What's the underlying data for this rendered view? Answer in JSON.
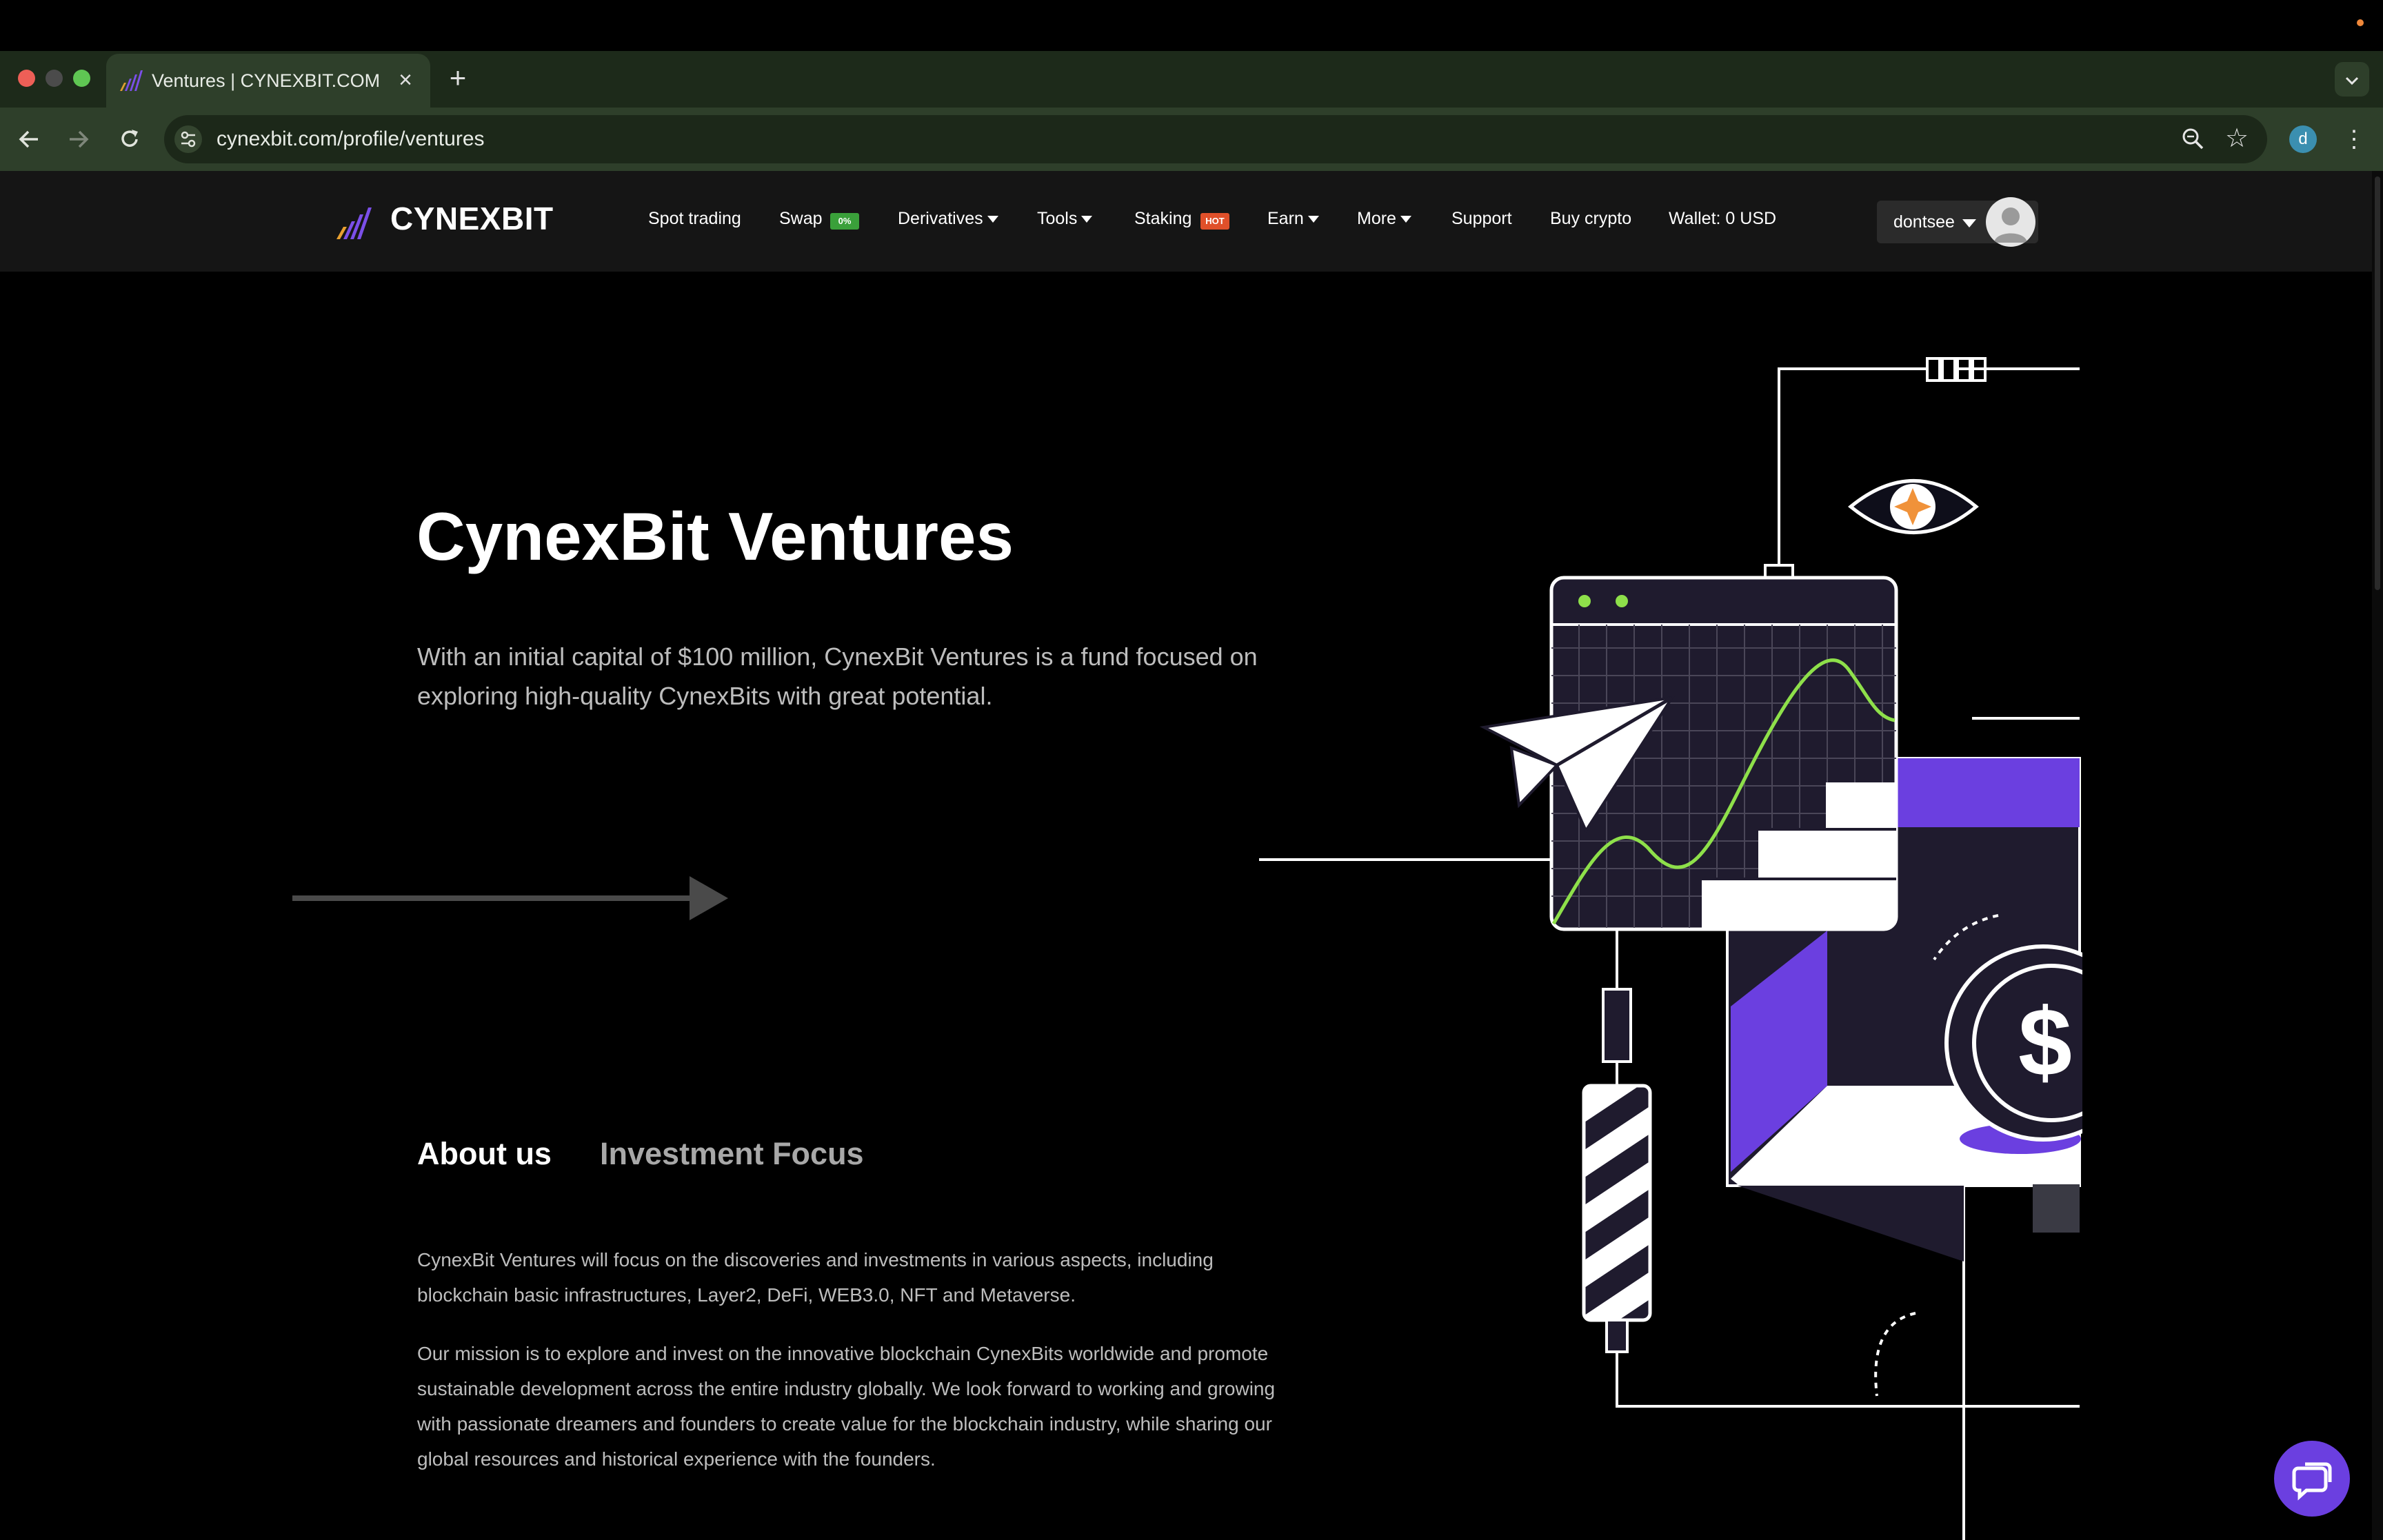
{
  "browser": {
    "tab_title": "Ventures | CYNEXBIT.COM",
    "tab_close": "×",
    "new_tab": "+",
    "url": "cynexbit.com/profile/ventures",
    "profile_initial": "d",
    "menu": "⋮"
  },
  "header": {
    "logo_text": "CYNEXBIT",
    "nav": {
      "spot_trading": "Spot trading",
      "swap": "Swap",
      "swap_badge": "0%",
      "derivatives": "Derivatives",
      "tools": "Tools",
      "staking": "Staking",
      "staking_badge": "HOT",
      "earn": "Earn",
      "more": "More",
      "support": "Support",
      "buy_crypto": "Buy crypto",
      "wallet": "Wallet: 0 USD"
    },
    "username": "dontsee"
  },
  "hero": {
    "title": "CynexBit Ventures",
    "description": "With an initial capital of $100 million, CynexBit Ventures is a fund focused on exploring high-quality CynexBits with great potential."
  },
  "tabs": {
    "about": "About us",
    "focus": "Investment Focus"
  },
  "about": {
    "paragraph1": "CynexBit Ventures will focus on the discoveries and investments in various aspects, including blockchain basic infrastructures, Layer2, DeFi, WEB3.0, NFT and Metaverse.",
    "paragraph2": "Our mission is to explore and invest on the innovative blockchain CynexBits worldwide and promote sustainable development across the entire industry globally. We look forward to working and growing with passionate dreamers and founders to create value for the blockchain industry, while sharing our global resources and historical experience with the founders."
  },
  "illustration": {
    "coin_symbol": "$"
  },
  "colors": {
    "accent_purple": "#6b3fe0",
    "chart_green": "#8ee04a",
    "swap_badge": "#3aa03a",
    "hot_badge": "#e0502a"
  }
}
